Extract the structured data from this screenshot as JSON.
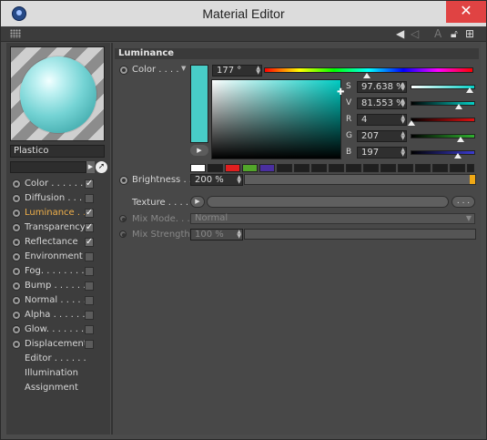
{
  "window": {
    "title": "Material Editor",
    "close": "✕"
  },
  "toolbar": {
    "icons": [
      "back-arrow-icon",
      "forward-arrow-icon",
      "text-icon",
      "lock-icon",
      "new-window-icon"
    ]
  },
  "material": {
    "name": "Plastico"
  },
  "channels": [
    {
      "label": "Color . . . . . .",
      "checked": true,
      "active": false
    },
    {
      "label": "Diffusion . . .",
      "checked": false,
      "active": false
    },
    {
      "label": "Luminance . .",
      "checked": true,
      "active": true
    },
    {
      "label": "Transparency",
      "checked": true,
      "active": false
    },
    {
      "label": "Reflectance",
      "checked": true,
      "active": false
    },
    {
      "label": "Environment",
      "checked": false,
      "active": false
    },
    {
      "label": "Fog. . . . . . . .",
      "checked": false,
      "active": false
    },
    {
      "label": "Bump . . . . . .",
      "checked": false,
      "active": false
    },
    {
      "label": "Normal . . . . .",
      "checked": false,
      "active": false
    },
    {
      "label": "Alpha . . . . . .",
      "checked": false,
      "active": false
    },
    {
      "label": "Glow. . . . . . .",
      "checked": false,
      "active": false
    },
    {
      "label": "Displacement",
      "checked": false,
      "active": false
    }
  ],
  "extra_items": [
    "Editor . . . . . .",
    "Illumination",
    "Assignment"
  ],
  "section": {
    "title": "Luminance"
  },
  "color": {
    "label": "Color . . . .",
    "hue": "177 °",
    "s_label": "S",
    "s_value": "97.638 %",
    "v_label": "V",
    "v_value": "81.553 %",
    "r_label": "R",
    "r_value": "4",
    "g_label": "G",
    "g_value": "207",
    "b_label": "B",
    "b_value": "197",
    "swatch": "#04cfc5",
    "s_level": 0.976,
    "v_level": 0.816,
    "r_level": 0.016,
    "g_level": 0.812,
    "b_level": 0.773,
    "hue_level": 0.49
  },
  "palette": [
    "#ffffff",
    "#1a1a1a",
    "#e01f1f",
    "#52a62a",
    "#4a2fa0",
    "#1a1a1a",
    "#1a1a1a",
    "#1a1a1a",
    "#1a1a1a",
    "#1a1a1a",
    "#1a1a1a",
    "#1a1a1a",
    "#1a1a1a",
    "#1a1a1a",
    "#1a1a1a",
    "#1a1a1a",
    "#1a1a1a",
    "#1a1a1a"
  ],
  "brightness": {
    "label": "Brightness . .",
    "value": "200 %"
  },
  "texture": {
    "label": "Texture . . . . .",
    "more": ". . ."
  },
  "mix_mode": {
    "label": "Mix Mode. . .",
    "value": "Normal"
  },
  "mix_strength": {
    "label": "Mix Strength",
    "value": "100 %"
  }
}
